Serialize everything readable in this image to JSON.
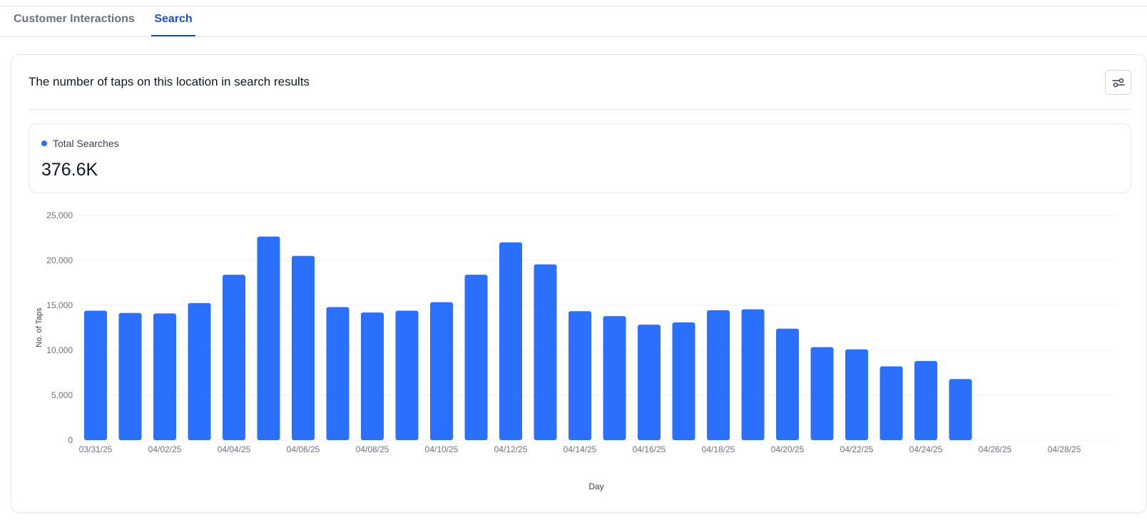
{
  "tabs": [
    {
      "label": "Customer Interactions",
      "active": false
    },
    {
      "label": "Search",
      "active": true
    }
  ],
  "card": {
    "title": "The number of taps on this location in search results",
    "filter_icon": "sliders-icon"
  },
  "metric": {
    "legend_label": "Total Searches",
    "value": "376.6K"
  },
  "colors": {
    "bar": "#2b6ffd",
    "active_tab": "#1d4ed8",
    "grid": "#f0f0f0"
  },
  "chart_data": {
    "type": "bar",
    "xlabel": "Day",
    "ylabel": "No. of Taps",
    "ylim": [
      0,
      25000
    ],
    "y_ticks": [
      "25,000",
      "20,000",
      "15,000",
      "10,000",
      "5,000",
      "0"
    ],
    "x_tick_labels": [
      "03/31/25",
      "04/02/25",
      "04/04/25",
      "04/06/25",
      "04/08/25",
      "04/10/25",
      "04/12/25",
      "04/14/25",
      "04/16/25",
      "04/18/25",
      "04/20/25",
      "04/22/25",
      "04/24/25",
      "04/26/25",
      "04/28/25"
    ],
    "categories": [
      "03/31/25",
      "04/01/25",
      "04/02/25",
      "04/03/25",
      "04/04/25",
      "04/05/25",
      "04/06/25",
      "04/07/25",
      "04/08/25",
      "04/09/25",
      "04/10/25",
      "04/11/25",
      "04/12/25",
      "04/13/25",
      "04/14/25",
      "04/15/25",
      "04/16/25",
      "04/17/25",
      "04/18/25",
      "04/19/25",
      "04/20/25",
      "04/21/25",
      "04/22/25",
      "04/23/25",
      "04/24/25",
      "04/25/25",
      "04/26/25",
      "04/27/25",
      "04/28/25",
      "04/29/25"
    ],
    "series": [
      {
        "values": [
          14400,
          14150,
          14100,
          15250,
          18400,
          22650,
          20500,
          14800,
          14200,
          14400,
          15350,
          18400,
          22000,
          19550,
          14350,
          13800,
          12850,
          13100,
          14450,
          14550,
          12400,
          10350,
          10100,
          8200,
          8800,
          6800,
          null,
          null,
          null,
          null
        ]
      }
    ],
    "grid": true
  }
}
